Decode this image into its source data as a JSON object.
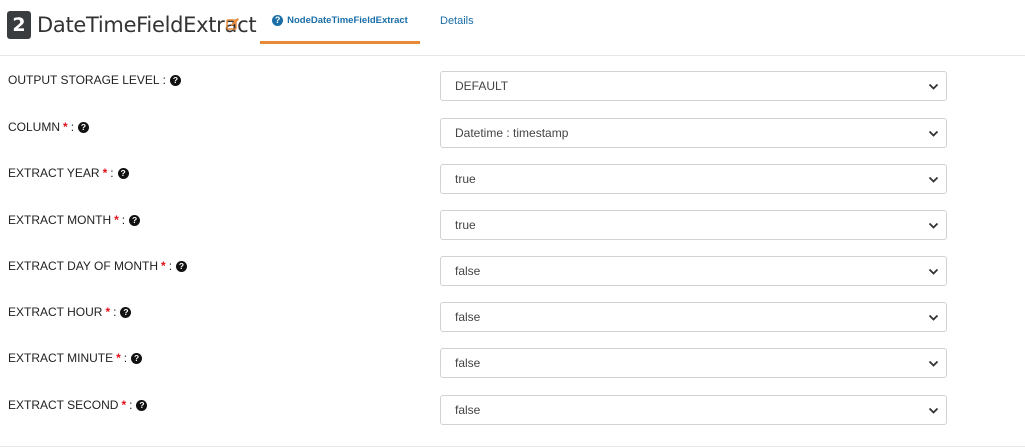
{
  "node": {
    "number": "2",
    "title": "DateTimeFieldExtract",
    "edit_icon": "edit-icon"
  },
  "tabs": [
    {
      "label": "NodeDateTimeFieldExtract",
      "icon": "question-circle-icon",
      "active": true
    },
    {
      "label": "Details",
      "active": false
    }
  ],
  "fields": [
    {
      "label": "OUTPUT STORAGE LEVEL",
      "required": false,
      "value": "DEFAULT"
    },
    {
      "label": "COLUMN",
      "required": true,
      "value": "Datetime : timestamp"
    },
    {
      "label": "EXTRACT YEAR",
      "required": true,
      "value": "true"
    },
    {
      "label": "EXTRACT MONTH",
      "required": true,
      "value": "true"
    },
    {
      "label": "EXTRACT DAY OF MONTH",
      "required": true,
      "value": "false"
    },
    {
      "label": "EXTRACT HOUR",
      "required": true,
      "value": "false"
    },
    {
      "label": "EXTRACT MINUTE",
      "required": true,
      "value": "false"
    },
    {
      "label": "EXTRACT SECOND",
      "required": true,
      "value": "false"
    }
  ],
  "symbols": {
    "required_mark": "*",
    "colon": ":",
    "help_glyph": "?"
  },
  "colors": {
    "accent_tab": "#e88a3a",
    "link": "#1a6ea8",
    "required": "#e0101a"
  }
}
